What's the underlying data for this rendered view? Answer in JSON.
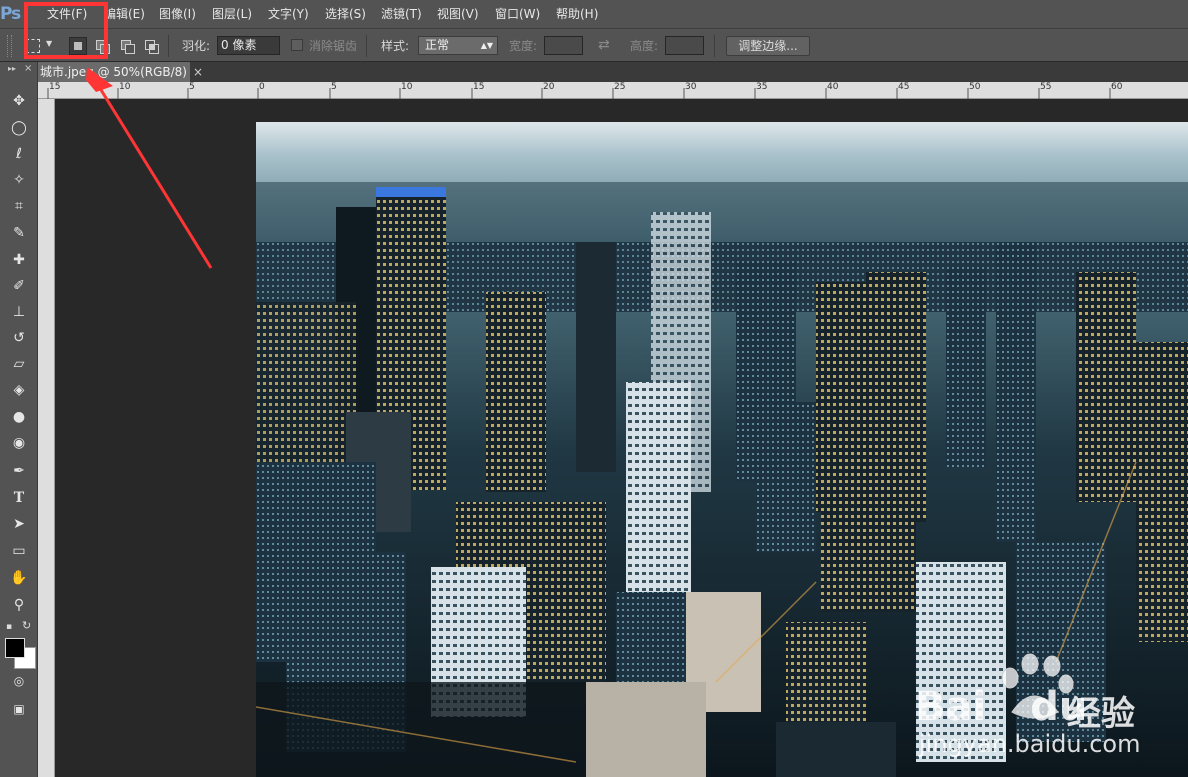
{
  "app": {
    "logo": "Ps"
  },
  "menubar": {
    "items": [
      "文件(F)",
      "编辑(E)",
      "图像(I)",
      "图层(L)",
      "文字(Y)",
      "选择(S)",
      "滤镜(T)",
      "视图(V)",
      "窗口(W)",
      "帮助(H)"
    ]
  },
  "options": {
    "feather_label": "羽化:",
    "feather_value": "0 像素",
    "antialias_label": "消除锯齿",
    "style_label": "样式:",
    "style_value": "正常",
    "width_label": "宽度:",
    "height_label": "高度:",
    "refine_edge_button": "调整边缘..."
  },
  "document": {
    "tab_title": "城市.jpeg @ 50%(RGB/8)",
    "close_glyph": "×"
  },
  "ruler": {
    "ticks": [
      "15",
      "10",
      "5",
      "0",
      "5",
      "10",
      "15",
      "20",
      "25",
      "30",
      "35",
      "40",
      "45",
      "50",
      "55",
      "60"
    ]
  },
  "watermark": {
    "brand": "Bai",
    "brand_suffix": "du",
    "product": "经验",
    "url": "jingyan.baidu.com"
  },
  "colors": {
    "ui_panel": "#535353",
    "canvas_bg": "#282828",
    "highlight": "#ff3535",
    "arrow": "#ff3535"
  },
  "icons": {
    "tools": [
      "move-tool-icon",
      "elliptical-marquee-icon",
      "lasso-icon",
      "magic-wand-icon",
      "crop-icon",
      "eyedropper-icon",
      "spot-healing-icon",
      "brush-icon",
      "clone-stamp-icon",
      "history-brush-icon",
      "eraser-icon",
      "paint-bucket-icon",
      "blur-icon",
      "dodge-icon",
      "pen-icon",
      "type-icon",
      "path-selection-icon",
      "shape-icon",
      "hand-icon",
      "zoom-icon"
    ]
  }
}
